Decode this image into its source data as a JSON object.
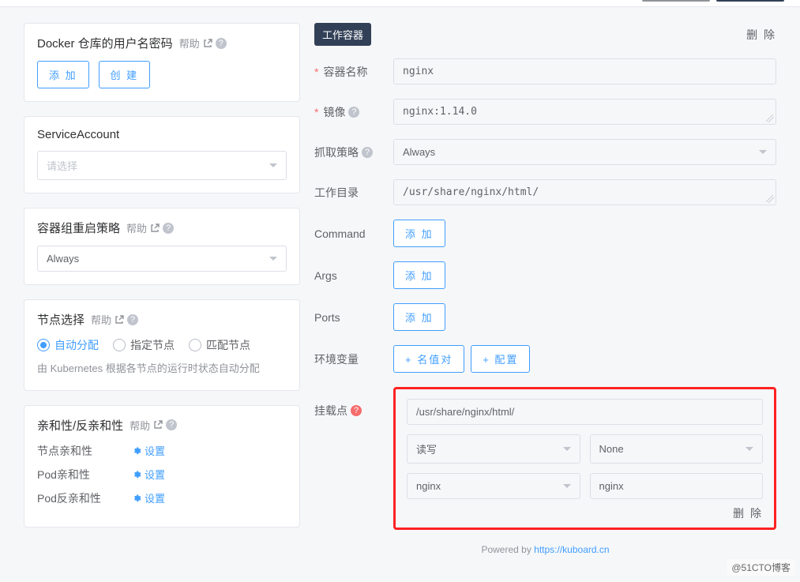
{
  "top": {},
  "docker": {
    "title": "Docker 仓库的用户名密码",
    "help": "帮助",
    "add": "添 加",
    "create": "创 建"
  },
  "sa": {
    "title": "ServiceAccount",
    "placeholder": "请选择"
  },
  "restart": {
    "title": "容器组重启策略",
    "help": "帮助",
    "value": "Always"
  },
  "nodesel": {
    "title": "节点选择",
    "help": "帮助",
    "options": [
      "自动分配",
      "指定节点",
      "匹配节点"
    ],
    "active": 0,
    "desc": "由 Kubernetes 根据各节点的运行时状态自动分配"
  },
  "aff": {
    "title": "亲和性/反亲和性",
    "help": "帮助",
    "rows": [
      "节点亲和性",
      "Pod亲和性",
      "Pod反亲和性"
    ],
    "set": "设置"
  },
  "container": {
    "tag": "工作容器",
    "del": "删 除",
    "name_label": "容器名称",
    "name_value": "nginx",
    "image_label": "镜像",
    "image_value": "nginx:1.14.0",
    "pull_label": "抓取策略",
    "pull_value": "Always",
    "workdir_label": "工作目录",
    "workdir_value": "/usr/share/nginx/html/",
    "command_label": "Command",
    "args_label": "Args",
    "ports_label": "Ports",
    "add": "添 加",
    "env_label": "环境变量",
    "env_kv": "+ 名值对",
    "env_cfg": "+ 配置",
    "mount_label": "挂载点",
    "mount_path": "/usr/share/nginx/html/",
    "mount_rw": "读写",
    "mount_none": "None",
    "mount_vol": "nginx",
    "mount_sub": "nginx",
    "mount_del": "删 除"
  },
  "footer": {
    "text1": "Powered by ",
    "link": "https://kuboard.cn"
  },
  "watermark": "@51CTO博客"
}
